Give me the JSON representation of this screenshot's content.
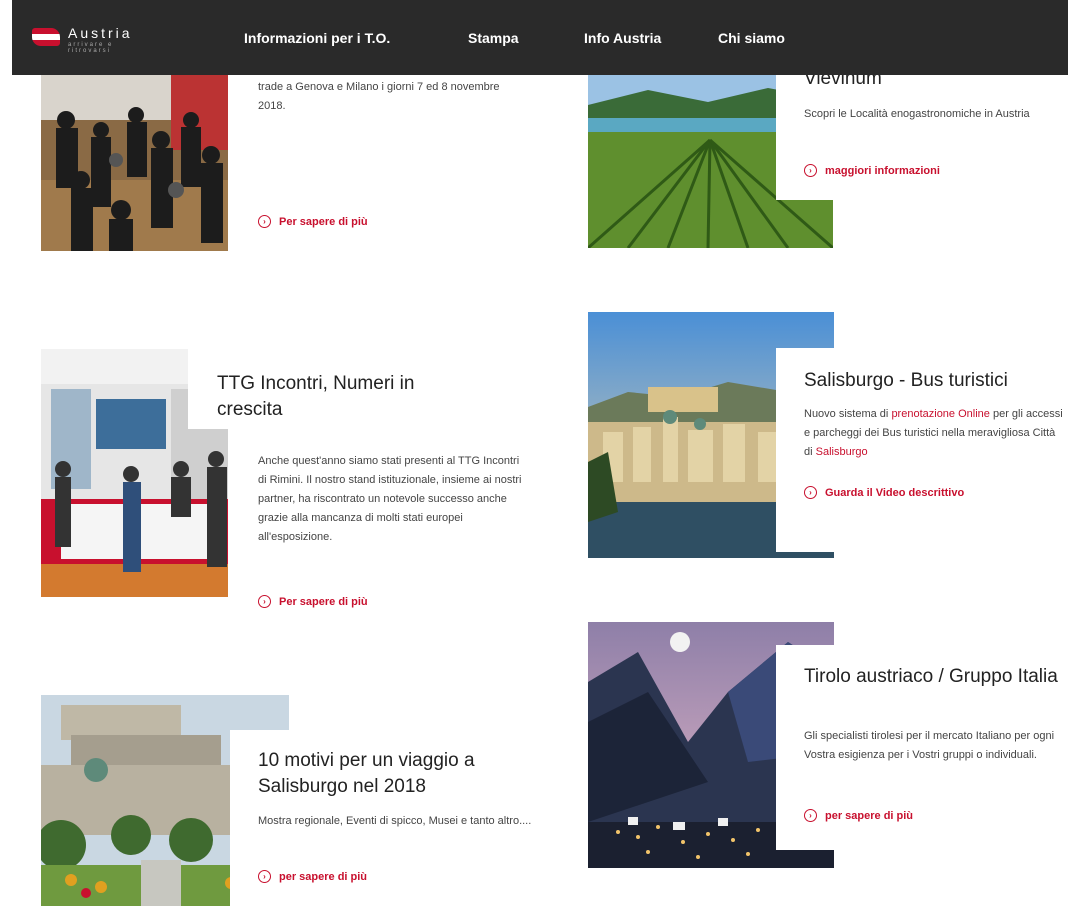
{
  "brand": {
    "name": "Austria",
    "tagline": "arrivare e ritrovarsi"
  },
  "nav": {
    "items": [
      "Informazioni per i T.O.",
      "Stampa",
      "Info Austria",
      "Chi siamo"
    ]
  },
  "articles": [
    {
      "title": "",
      "desc": "trade a Genova e Milano i giorni 7 ed 8 novembre 2018.",
      "cta": "Per sapere di più"
    },
    {
      "title": "TTG Incontri, Numeri in crescita",
      "desc": "Anche quest'anno siamo stati presenti al TTG Incontri di Rimini. Il nostro stand istituzionale, insieme ai nostri partner, ha riscontrato un notevole successo anche grazie alla mancanza di molti stati europei all'esposizione.",
      "cta": "Per sapere di più"
    },
    {
      "title": "10 motivi per un viaggio a Salisburgo nel 2018",
      "desc": "Mostra regionale, Eventi di spicco, Musei e tanto altro....",
      "cta": "per sapere di più"
    },
    {
      "title": "Vievinum",
      "desc": "Scopri le Località enogastronomiche in Austria",
      "cta": "maggiori informazioni"
    },
    {
      "title": "Salisburgo - Bus turistici",
      "desc_a": "Nuovo sistema di ",
      "desc_link1": "prenotazione Online",
      "desc_b": " per gli accessi e parcheggi dei Bus turistici nella meravigliosa Città di ",
      "desc_link2": "Salisburgo",
      "cta": "Guarda il Video descrittivo"
    },
    {
      "title": "Tirolo austriaco / Gruppo Italia",
      "desc": "Gli specialisti tirolesi per il mercato Italiano per ogni Vostra esigienza per i Vostri gruppi o individuali.",
      "cta": "per sapere di più"
    }
  ],
  "colors": {
    "accent": "#c8102e",
    "nav_bg": "#2a2a2a"
  }
}
